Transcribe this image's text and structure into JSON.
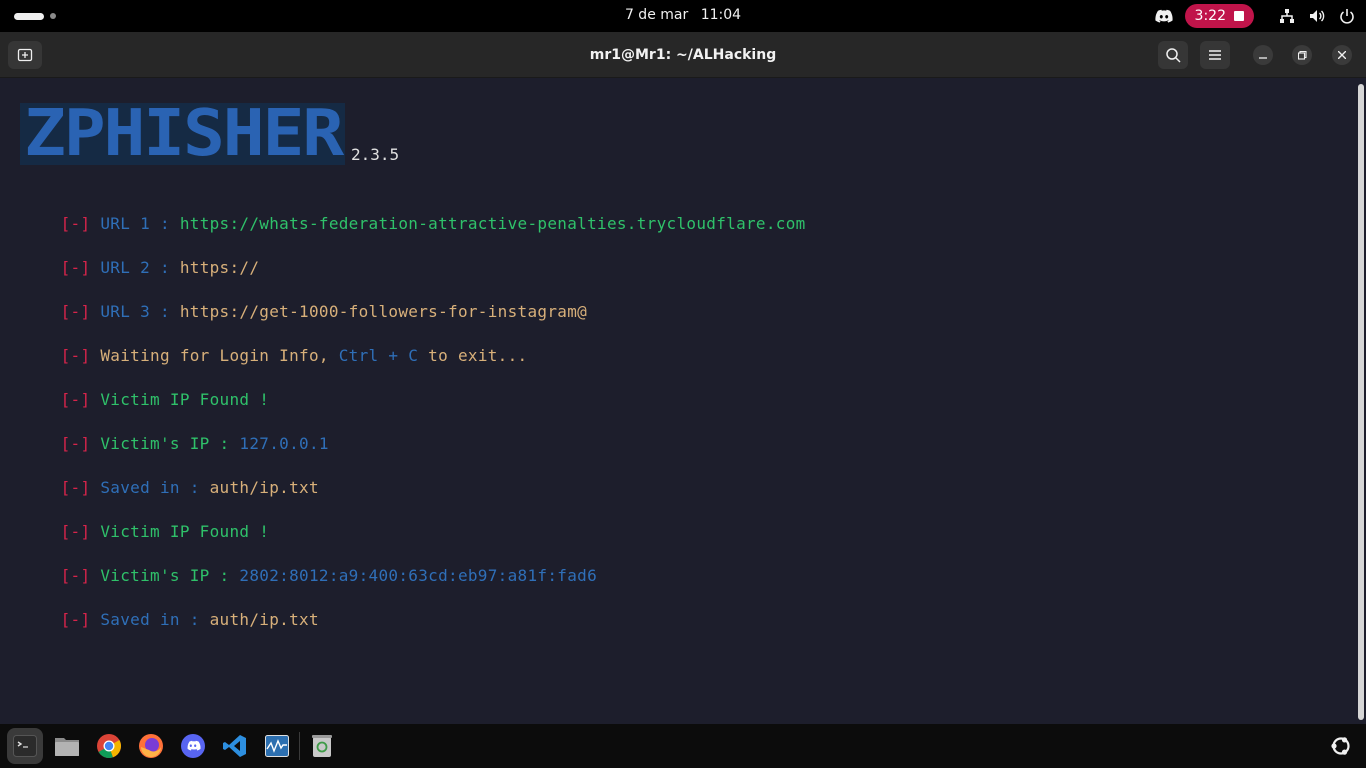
{
  "topbar": {
    "date": "7 de mar",
    "time": "11:04",
    "recording_time": "3:22",
    "icons": [
      "activities-indicator",
      "discord-tray-icon",
      "recording-stop-icon",
      "network-icon",
      "volume-icon",
      "power-icon"
    ]
  },
  "window": {
    "title": "mr1@Mr1: ~/ALHacking",
    "buttons": [
      "new-tab-icon",
      "search-icon",
      "menu-icon",
      "minimize-icon",
      "maximize-icon",
      "close-icon"
    ]
  },
  "terminal": {
    "banner": "ZPHISHER",
    "version": "2.3.5",
    "bracket_prefix": "[-]",
    "lines": [
      {
        "label": "URL 1 : ",
        "value": "https://whats-federation-attractive-penalties.trycloudflare.com"
      },
      {
        "label": "URL 2 : ",
        "value": "https://"
      },
      {
        "label": "URL 3 : ",
        "value": "https://get-1000-followers-for-instagram@"
      },
      {
        "label": "Waiting for Login Info, ",
        "ctrl": "Ctrl + C",
        "tail": " to exit..."
      },
      {
        "label": "Victim IP Found !"
      },
      {
        "label": "Victim's IP : ",
        "value": "127.0.0.1"
      },
      {
        "label": "Saved in : ",
        "value": "auth/ip.txt"
      },
      {
        "label": "Victim IP Found !"
      },
      {
        "label": "Victim's IP : ",
        "value": "2802:8012:a9:400:63cd:eb97:a81f:fad6"
      },
      {
        "label": "Saved in : ",
        "value": "auth/ip.txt"
      }
    ]
  },
  "colors": {
    "terminal_bg": "#1d1e2c",
    "bracket_red": "#d6244b",
    "label_blue": "#2f6fb8",
    "text_green": "#2fc16a",
    "url_orange": "#d8b07a",
    "recording_red": "#c0144a"
  },
  "dock": {
    "items": [
      "terminal-icon",
      "files-icon",
      "chrome-icon",
      "firefox-icon",
      "discord-icon",
      "vscode-icon",
      "system-monitor-icon",
      "trash-icon",
      "ubuntu-apps-icon"
    ]
  }
}
